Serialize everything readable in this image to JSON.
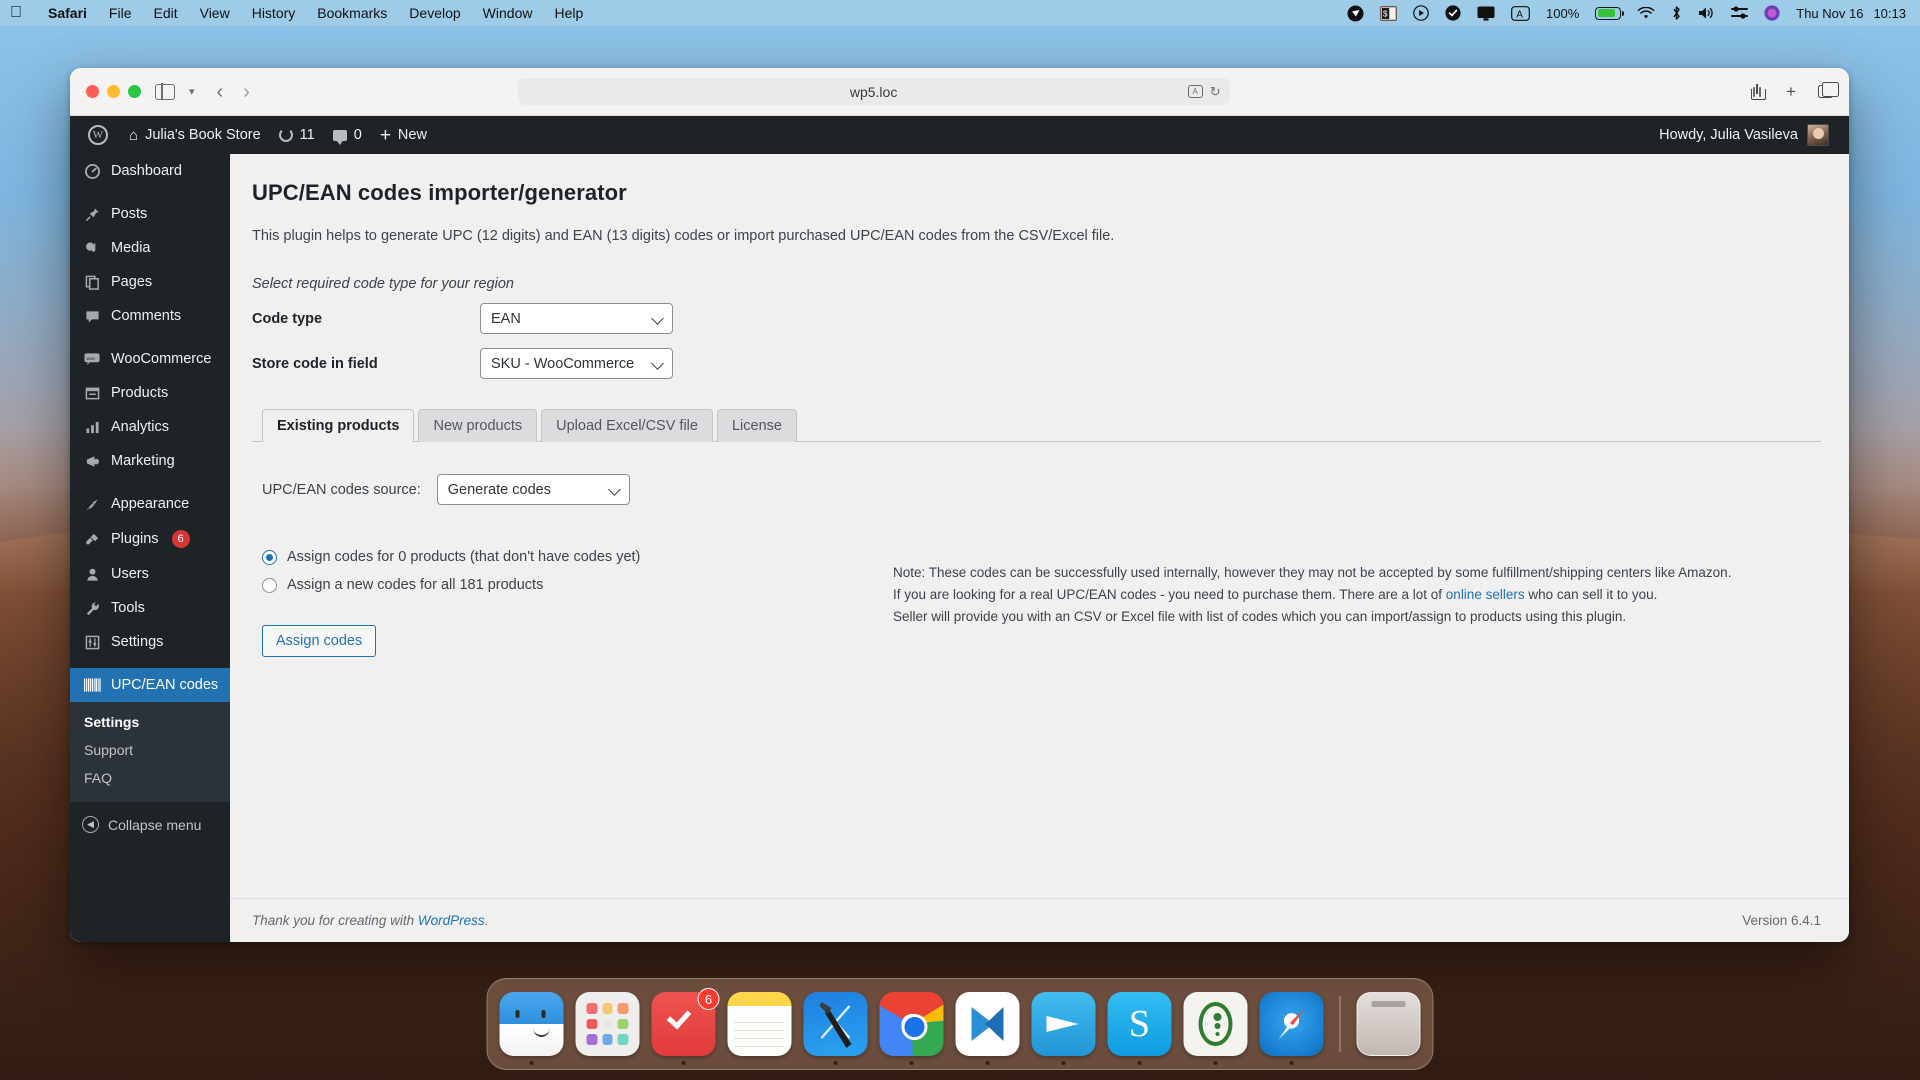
{
  "menubar": {
    "apple": "apple-logo",
    "items": [
      "Safari",
      "File",
      "Edit",
      "View",
      "History",
      "Bookmarks",
      "Develop",
      "Window",
      "Help"
    ],
    "status_icons": [
      "vpn-icon",
      "dollar-note-icon",
      "play-circle-icon",
      "checkmark-circle-icon",
      "display-icon",
      "keyboard-input-icon"
    ],
    "battery_percent": "100%",
    "day_time": "Thu Nov 16  10:13",
    "date": "Thu Nov 16",
    "time": "10:13"
  },
  "browser": {
    "url": "wp5.loc",
    "back_label": "‹",
    "forward_label": "›",
    "sidebar_label": "sidebar-toggle",
    "share_label": "share",
    "newtab_label": "+",
    "tabs_label": "tab-overview"
  },
  "adminbar": {
    "site_name": "Julia's Book Store",
    "updates_count": "11",
    "comments_count": "0",
    "new_label": "New",
    "howdy": "Howdy, Julia Vasileva"
  },
  "sidebar": {
    "items": [
      {
        "label": "Dashboard",
        "icon": "dashboard-icon",
        "badge": null
      },
      {
        "label": "Posts",
        "icon": "pin-icon",
        "badge": null
      },
      {
        "label": "Media",
        "icon": "media-icon",
        "badge": null
      },
      {
        "label": "Pages",
        "icon": "pages-icon",
        "badge": null
      },
      {
        "label": "Comments",
        "icon": "comment-icon",
        "badge": null
      },
      {
        "label": "WooCommerce",
        "icon": "woocommerce-icon",
        "badge": null
      },
      {
        "label": "Products",
        "icon": "products-icon",
        "badge": null
      },
      {
        "label": "Analytics",
        "icon": "analytics-icon",
        "badge": null
      },
      {
        "label": "Marketing",
        "icon": "megaphone-icon",
        "badge": null
      },
      {
        "label": "Appearance",
        "icon": "brush-icon",
        "badge": null
      },
      {
        "label": "Plugins",
        "icon": "plug-icon",
        "badge": "6"
      },
      {
        "label": "Users",
        "icon": "user-icon",
        "badge": null
      },
      {
        "label": "Tools",
        "icon": "wrench-icon",
        "badge": null
      },
      {
        "label": "Settings",
        "icon": "settings-icon",
        "badge": null
      },
      {
        "label": "UPC/EAN codes",
        "icon": "barcode-icon",
        "badge": null,
        "current": true
      }
    ],
    "submenu": [
      {
        "label": "Settings",
        "current": true
      },
      {
        "label": "Support",
        "current": false
      },
      {
        "label": "FAQ",
        "current": false
      }
    ],
    "collapse_label": "Collapse menu"
  },
  "page": {
    "title": "UPC/EAN codes importer/generator",
    "intro": "This plugin helps to generate UPC (12 digits) and EAN (13 digits) codes or import purchased UPC/EAN codes from the CSV/Excel file.",
    "select_hint": "Select required code type for your region",
    "fields": [
      {
        "label": "Code type",
        "value": "EAN"
      },
      {
        "label": "Store code in field",
        "value": "SKU - WooCommerce"
      }
    ],
    "tabs": [
      {
        "label": "Existing products",
        "active": true
      },
      {
        "label": "New products",
        "active": false
      },
      {
        "label": "Upload Excel/CSV file",
        "active": false
      },
      {
        "label": "License",
        "active": false
      }
    ],
    "source_label": "UPC/EAN codes source:",
    "source_value": "Generate codes",
    "note_lines": [
      "Note: These codes can be successfully used internally, however they may not be accepted by some fulfillment/shipping centers like Amazon.",
      "If you are looking for a real UPC/EAN codes - you need to purchase them. There are a lot of ",
      " who can sell it to you.",
      "Seller will provide you with an CSV or Excel file with list of codes which you can import/assign to products using this plugin."
    ],
    "note_link": "online sellers",
    "radios": [
      {
        "label": "Assign codes for 0 products (that don't have codes yet)",
        "selected": true
      },
      {
        "label": "Assign a new codes for all 181 products",
        "selected": false
      }
    ],
    "assign_button": "Assign codes",
    "footer_thanks_prefix": "Thank you for creating with ",
    "footer_link": "WordPress",
    "footer_thanks_suffix": ".",
    "version": "Version 6.4.1"
  },
  "dock": {
    "apps": [
      {
        "name": "finder",
        "badge": null,
        "running": true
      },
      {
        "name": "launchpad",
        "badge": null,
        "running": false
      },
      {
        "name": "things",
        "badge": "6",
        "running": true
      },
      {
        "name": "notes",
        "badge": null,
        "running": false
      },
      {
        "name": "xcode",
        "badge": null,
        "running": true
      },
      {
        "name": "google-chrome",
        "badge": null,
        "running": true
      },
      {
        "name": "visual-studio-code",
        "badge": null,
        "running": true
      },
      {
        "name": "telegram",
        "badge": null,
        "running": true
      },
      {
        "name": "skype",
        "badge": null,
        "running": true
      },
      {
        "name": "keepassxc",
        "badge": null,
        "running": true
      },
      {
        "name": "safari",
        "badge": null,
        "running": true
      },
      {
        "name": "trash",
        "badge": null,
        "running": false
      }
    ]
  },
  "colors": {
    "wp_dark": "#1d2327",
    "wp_accent": "#2271b1",
    "badge_red": "#d63638",
    "admin_bg": "#f0f0f1"
  }
}
